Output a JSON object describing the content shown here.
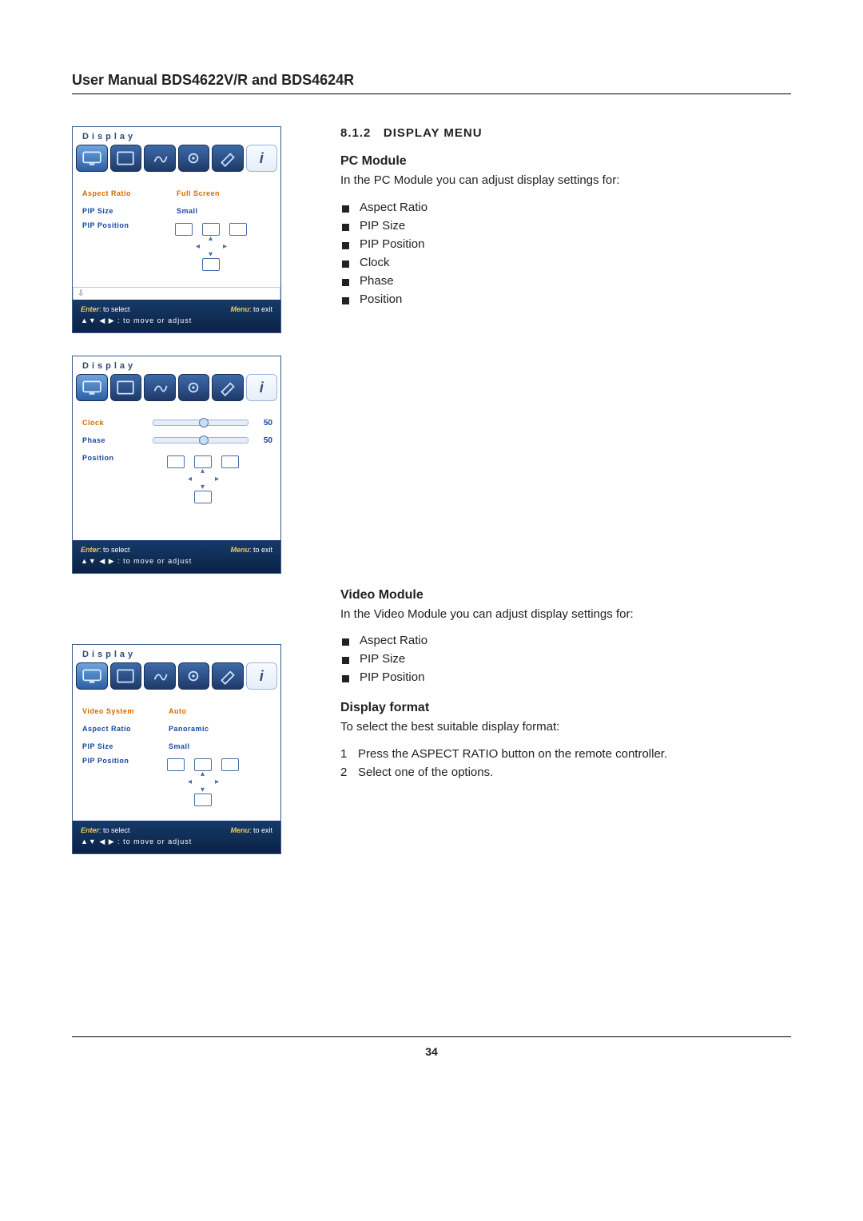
{
  "header": {
    "title": "User Manual BDS4622V/R and BDS4624R"
  },
  "section": {
    "number": "8.1.2",
    "title": "DISPLAY MENU"
  },
  "pc_module": {
    "heading": "PC Module",
    "intro": "In the PC Module you can adjust display settings for:",
    "items": [
      "Aspect Ratio",
      "PIP Size",
      "PIP Position",
      "Clock",
      "Phase",
      "Position"
    ]
  },
  "video_module": {
    "heading": "Video Module",
    "intro": "In the Video Module you can adjust display settings for:",
    "items": [
      "Aspect Ratio",
      "PIP Size",
      "PIP Position"
    ]
  },
  "display_format": {
    "heading": "Display format",
    "intro": "To select the best suitable display format:",
    "steps": [
      "Press the ASPECT RATIO button on the remote controller.",
      "Select one of the options."
    ]
  },
  "panels": {
    "panel_title": "Display",
    "footer_enter": "Enter",
    "footer_enter_txt": ": to select",
    "footer_menu": "Menu",
    "footer_menu_txt": ": to exit",
    "footer_line2": "▲▼ ◀ ▶ :  to move or adjust",
    "p1": {
      "rows": [
        {
          "label": "Aspect Ratio",
          "value": "Full Screen",
          "selected": true
        },
        {
          "label": "PIP Size",
          "value": "Small",
          "selected": false
        },
        {
          "label": "PIP Position",
          "value": "",
          "selected": false,
          "pip": true
        }
      ]
    },
    "p2": {
      "rows": [
        {
          "label": "Clock",
          "slider": 50,
          "selected": true
        },
        {
          "label": "Phase",
          "slider": 50,
          "selected": false
        },
        {
          "label": "Position",
          "pip": true,
          "selected": false
        }
      ]
    },
    "p3": {
      "rows": [
        {
          "label": "Video System",
          "value": "Auto",
          "selected": true
        },
        {
          "label": "Aspect Ratio",
          "value": "Panoramic",
          "selected": false
        },
        {
          "label": "PIP Size",
          "value": "Small",
          "selected": false
        },
        {
          "label": "PIP Position",
          "pip": true,
          "selected": false
        }
      ]
    }
  },
  "page_number": "34"
}
